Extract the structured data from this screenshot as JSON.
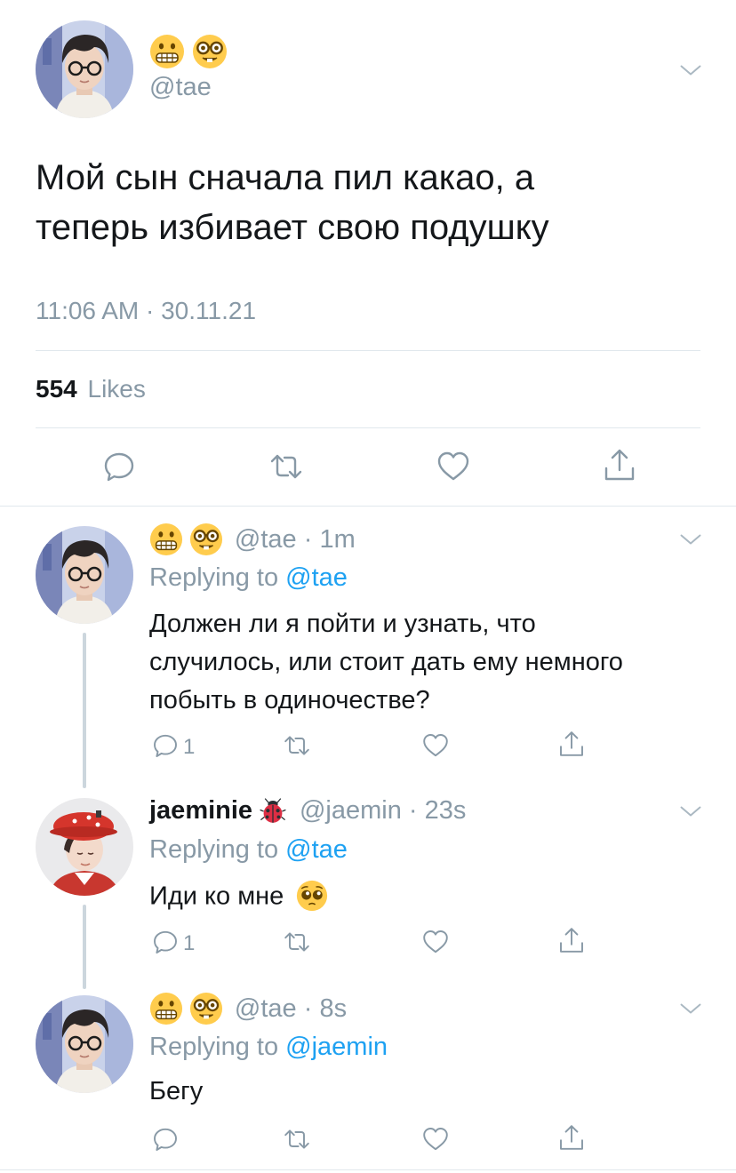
{
  "main_tweet": {
    "handle": "@tae",
    "text_line1": "Мой сын сначала пил какао, а",
    "text_line2": "теперь избивает свою подушку",
    "timestamp": "11:06 AM · 30.11.21",
    "likes_count": "554",
    "likes_label": "Likes"
  },
  "replies": [
    {
      "handle": "@tae",
      "time": "1m",
      "replying_prefix": "Replying to",
      "replying_to": "@tae",
      "text_lines": [
        "Должен ли я пойти и узнать, что",
        "случилось, или стоит дать ему немного",
        "побыть в одиночестве?"
      ],
      "reply_count": "1"
    },
    {
      "display_name": "jaeminie",
      "handle": "@jaemin",
      "time": "23s",
      "replying_prefix": "Replying to",
      "replying_to": "@tae",
      "text": "Иди ко мне",
      "reply_count": "1"
    },
    {
      "handle": "@tae",
      "time": "8s",
      "replying_prefix": "Replying to",
      "replying_to": "@jaemin",
      "text": "Бегу"
    }
  ],
  "icons": [
    "grimacing-emoji",
    "nerd-emoji",
    "ladybug-emoji",
    "pleading-emoji",
    "chevron-down-icon",
    "reply-icon",
    "retweet-icon",
    "like-icon",
    "share-icon"
  ],
  "colors": {
    "link": "#1da1f2",
    "muted": "#8899a6",
    "divider": "#e1e8ed",
    "text": "#14171a"
  }
}
